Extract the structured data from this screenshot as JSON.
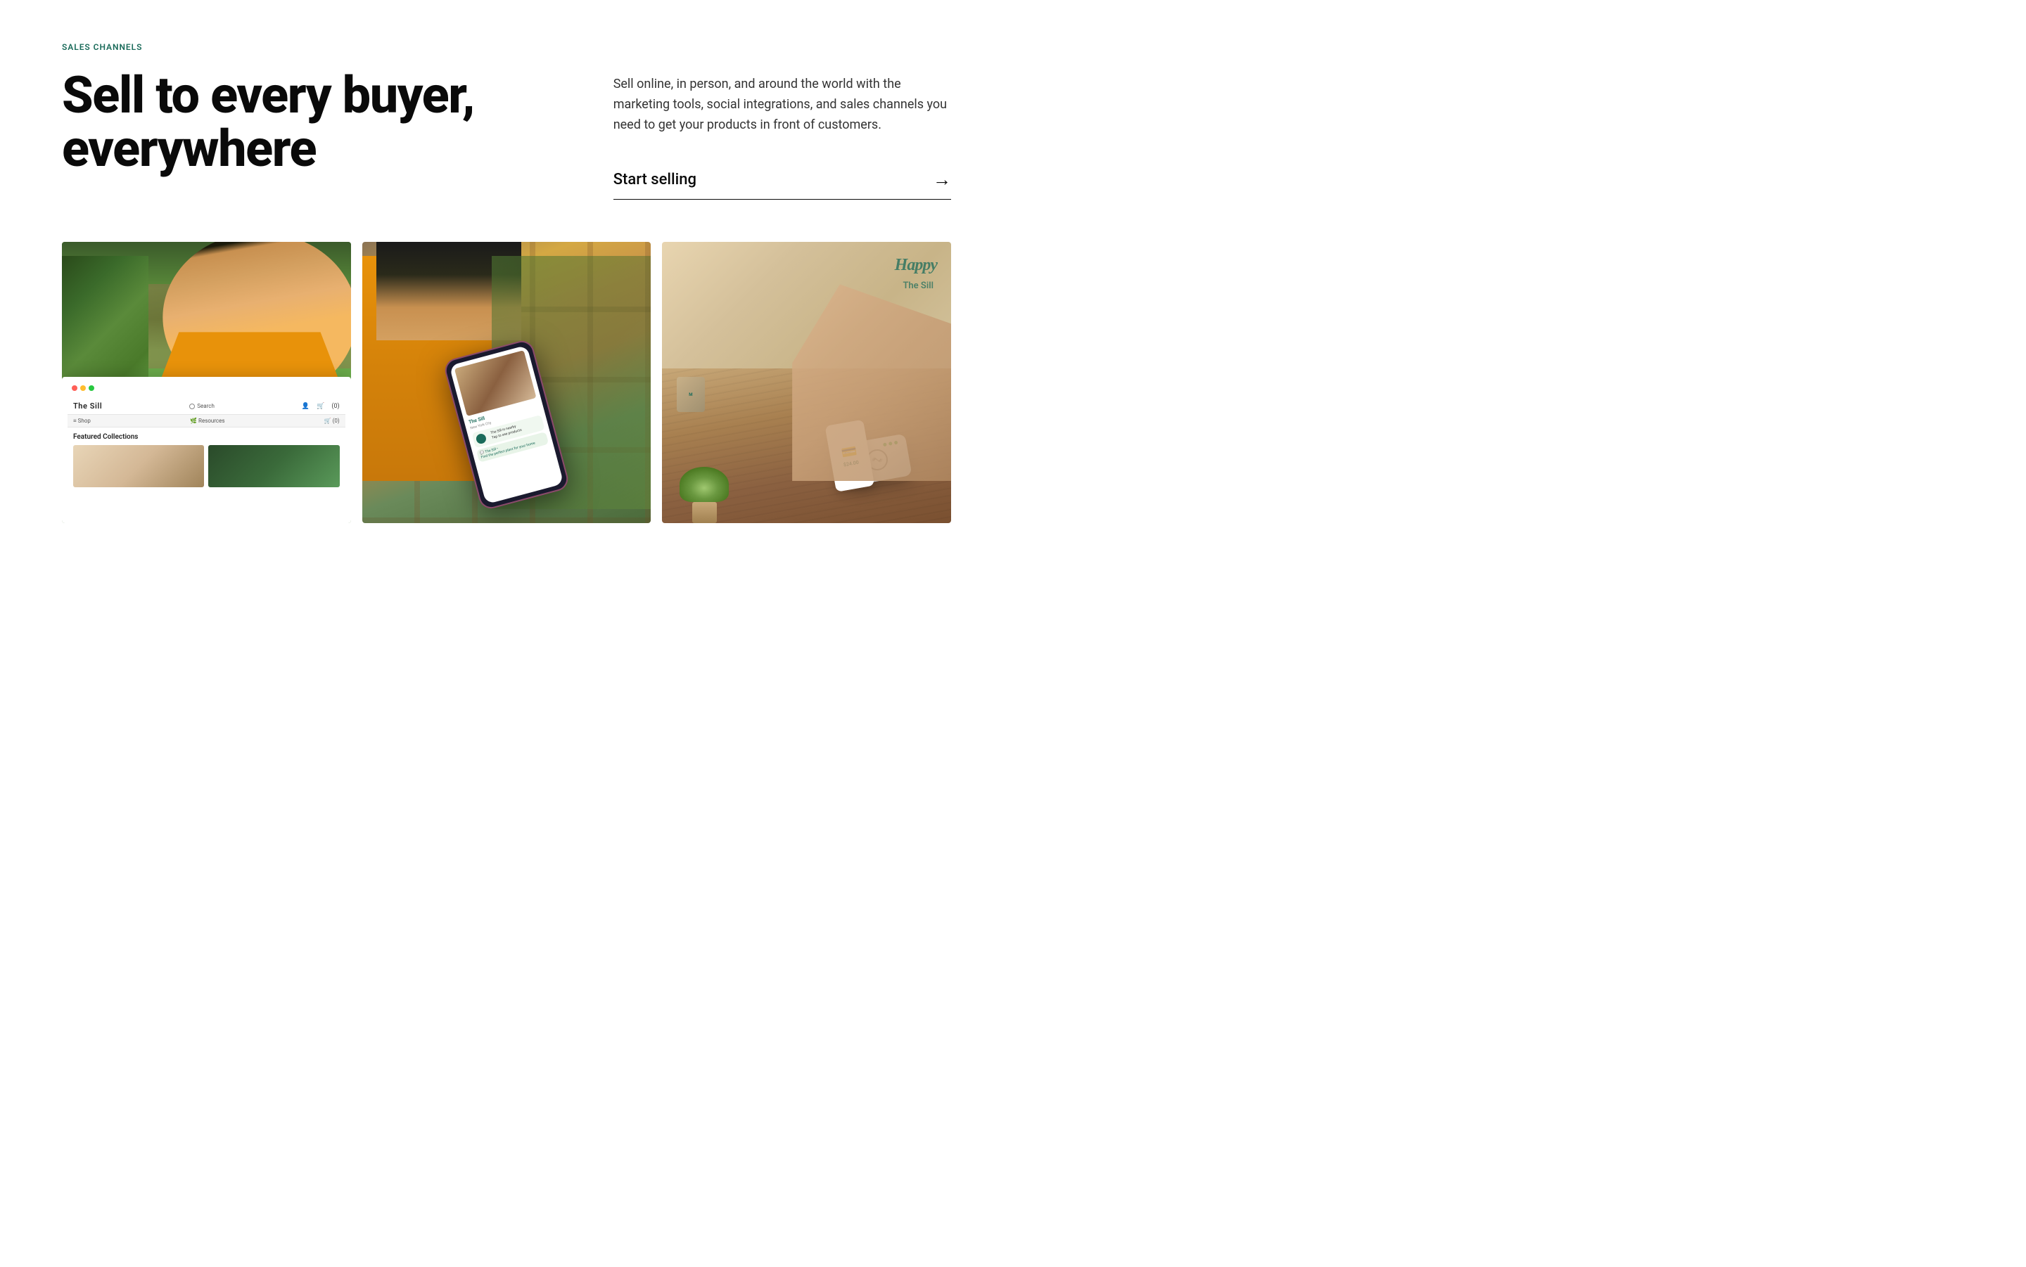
{
  "page": {
    "background": "#ffffff"
  },
  "section": {
    "label": "SALES CHANNELS",
    "headline_line1": "Sell to every buyer,",
    "headline_line2": "everywhere",
    "description": "Sell online, in person, and around the world with the marketing tools, social integrations, and sales channels you need to get your products in front of customers.",
    "cta_text": "Start selling",
    "cta_arrow": "→"
  },
  "browser_mockup": {
    "brand": "The    Sill",
    "search_label": "Search",
    "cart_label": "(0)",
    "nav_shop": "Shop",
    "nav_resources": "Resources",
    "nav_cart2": "(0)",
    "featured_label": "Featured Collections"
  },
  "phone_mockup": {
    "shop_name": "The Sill",
    "location": "New York City"
  },
  "images": [
    {
      "id": "img1",
      "alt": "Woman smiling in plant shop with browser mockup overlay"
    },
    {
      "id": "img2",
      "alt": "Person holding phone in plant shop"
    },
    {
      "id": "img3",
      "alt": "Card reader with phone tap to pay on wooden surface"
    }
  ],
  "colors": {
    "accent_green": "#1a6b5a",
    "headline_dark": "#0a0a0a",
    "text_body": "#333333",
    "border_dark": "#0a0a0a"
  }
}
